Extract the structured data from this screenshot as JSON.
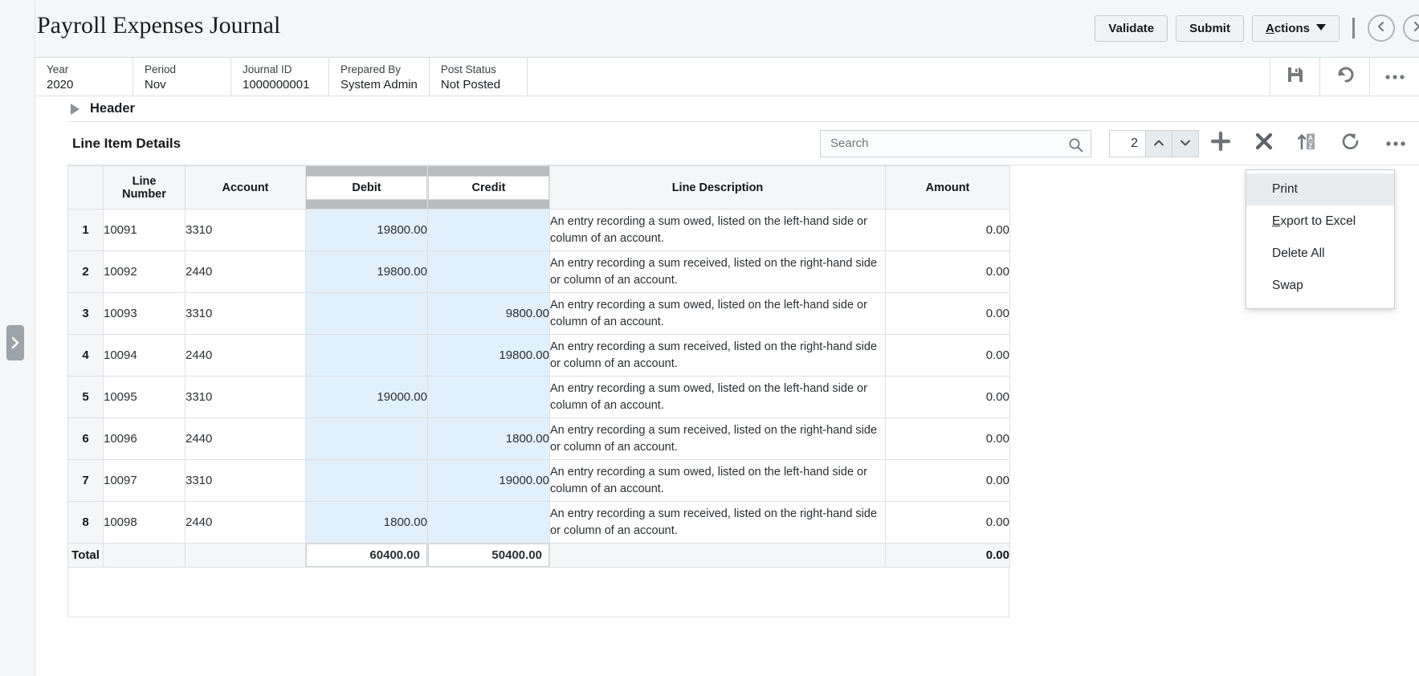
{
  "page": {
    "title": "Payroll Expenses Journal"
  },
  "title_actions": {
    "validate_label": "Validate",
    "submit_label": "Submit",
    "actions_label_accesskey": "A",
    "actions_label_rest": "ctions",
    "prev_icon": "chevron-left-circle-icon",
    "next_icon": "chevron-right-circle-icon"
  },
  "summary": {
    "fields": [
      {
        "label": "Year",
        "value": "2020"
      },
      {
        "label": "Period",
        "value": "Nov"
      },
      {
        "label": "Journal ID",
        "value": "1000000001"
      },
      {
        "label": "Prepared By",
        "value": "System Admin"
      },
      {
        "label": "Post Status",
        "value": "Not Posted"
      }
    ],
    "icons": [
      {
        "name": "save-icon"
      },
      {
        "name": "undo-icon"
      },
      {
        "name": "more-options-icon"
      }
    ]
  },
  "header_section": {
    "label": "Header",
    "expanded": false,
    "toggle_icon": "triangle-right-icon"
  },
  "line_items": {
    "title": "Line Item Details",
    "search": {
      "placeholder": "Search",
      "value": "",
      "icon": "search-icon"
    },
    "row_spinner": {
      "value": "2",
      "up_icon": "chevron-up-icon",
      "down_icon": "chevron-down-icon"
    },
    "toolbar_icons": [
      {
        "name": "add-row-icon",
        "label": "Add"
      },
      {
        "name": "delete-row-icon",
        "label": "Delete"
      },
      {
        "name": "sort-az-icon",
        "label": "Sort"
      },
      {
        "name": "refresh-icon",
        "label": "Refresh"
      },
      {
        "name": "more-options-icon",
        "label": "More"
      }
    ],
    "columns": [
      {
        "key": "rownum",
        "label": ""
      },
      {
        "key": "line_number",
        "label": "Line\nNumber"
      },
      {
        "key": "account",
        "label": "Account"
      },
      {
        "key": "debit",
        "label": "Debit",
        "selected": true
      },
      {
        "key": "credit",
        "label": "Credit",
        "selected": true
      },
      {
        "key": "description",
        "label": "Line Description"
      },
      {
        "key": "amount",
        "label": "Amount"
      }
    ],
    "column_labels": {
      "line_number_top": "Line",
      "line_number_bottom": "Number",
      "account": "Account",
      "debit": "Debit",
      "credit": "Credit",
      "description": "Line Description",
      "amount": "Amount"
    },
    "descriptions": {
      "debit": "An entry recording a sum owed, listed on the left-hand side or column of an account.",
      "credit": "An entry recording a sum received, listed on the right-hand side or column of an account."
    },
    "rows": [
      {
        "n": "1",
        "line_number": "10091",
        "account": "3310",
        "debit": "19800.00",
        "credit": "",
        "description": "An entry recording a sum owed, listed on the left-hand side or column of an account.",
        "amount": "0.00"
      },
      {
        "n": "2",
        "line_number": "10092",
        "account": "2440",
        "debit": "19800.00",
        "credit": "",
        "description": "An entry recording a sum received, listed on the right-hand side or column of an account.",
        "amount": "0.00"
      },
      {
        "n": "3",
        "line_number": "10093",
        "account": "3310",
        "debit": "",
        "credit": "9800.00",
        "description": "An entry recording a sum owed, listed on the left-hand side or column of an account.",
        "amount": "0.00"
      },
      {
        "n": "4",
        "line_number": "10094",
        "account": "2440",
        "debit": "",
        "credit": "19800.00",
        "description": "An entry recording a sum received, listed on the right-hand side or column of an account.",
        "amount": "0.00"
      },
      {
        "n": "5",
        "line_number": "10095",
        "account": "3310",
        "debit": "19000.00",
        "credit": "",
        "description": "An entry recording a sum owed, listed on the left-hand side or column of an account.",
        "amount": "0.00"
      },
      {
        "n": "6",
        "line_number": "10096",
        "account": "2440",
        "debit": "",
        "credit": "1800.00",
        "description": "An entry recording a sum received, listed on the right-hand side or column of an account.",
        "amount": "0.00"
      },
      {
        "n": "7",
        "line_number": "10097",
        "account": "3310",
        "debit": "",
        "credit": "19000.00",
        "description": "An entry recording a sum owed, listed on the left-hand side or column of an account.",
        "amount": "0.00"
      },
      {
        "n": "8",
        "line_number": "10098",
        "account": "2440",
        "debit": "1800.00",
        "credit": "",
        "description": "An entry recording a sum received, listed on the right-hand side or column of an account.",
        "amount": "0.00"
      }
    ],
    "total_row": {
      "label": "Total",
      "debit": "60400.00",
      "credit": "50400.00",
      "amount": "0.00"
    }
  },
  "context_menu": {
    "items": [
      {
        "label": "Print",
        "hover": true
      },
      {
        "label_accesskey": "E",
        "label_rest": "xport to Excel",
        "label": "Export to Excel",
        "hover": false
      },
      {
        "label": "Delete All",
        "hover": false
      },
      {
        "label": "Swap",
        "hover": false
      }
    ]
  },
  "sidebar": {
    "handle_icon": "chevron-right-icon"
  },
  "colors": {
    "selected_column": "#b9bcbf",
    "money_cell": "#e2f0fb",
    "header_bg": "#f4f6f8",
    "menu_hover": "#e9ecef"
  }
}
